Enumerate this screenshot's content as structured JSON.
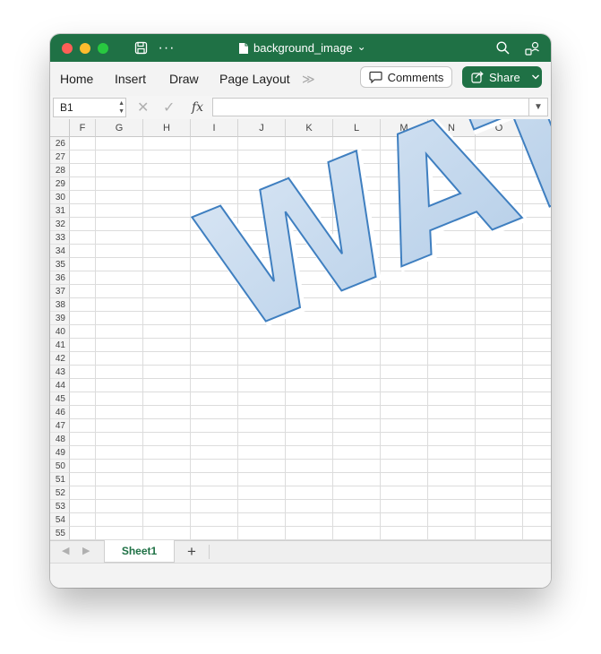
{
  "window": {
    "title": "background_image",
    "title_chevron": "⌄"
  },
  "ribbon": {
    "tabs": [
      "Home",
      "Insert",
      "Draw",
      "Page Layout"
    ],
    "overflow": "≫",
    "comments_label": "Comments",
    "share_label": "Share"
  },
  "formula_bar": {
    "name_box": "B1",
    "fx_label": "fx",
    "formula": ""
  },
  "grid": {
    "columns": [
      "F",
      "G",
      "H",
      "I",
      "J",
      "K",
      "L",
      "M",
      "N",
      "O",
      "P"
    ],
    "rows": [
      26,
      27,
      28,
      29,
      30,
      31,
      32,
      33,
      34,
      35,
      36,
      37,
      38,
      39,
      40,
      41,
      42,
      43,
      44,
      45,
      46,
      47,
      48,
      49,
      50,
      51,
      52,
      53,
      54,
      55
    ]
  },
  "watermark": {
    "text": "WATER",
    "fill": "#c3d7ec",
    "stroke": "#2f6fb3"
  },
  "sheet_tabs": {
    "active": "Sheet1",
    "add": "+"
  },
  "colors": {
    "titlebar": "#1f7145",
    "accent": "#1f7145"
  }
}
